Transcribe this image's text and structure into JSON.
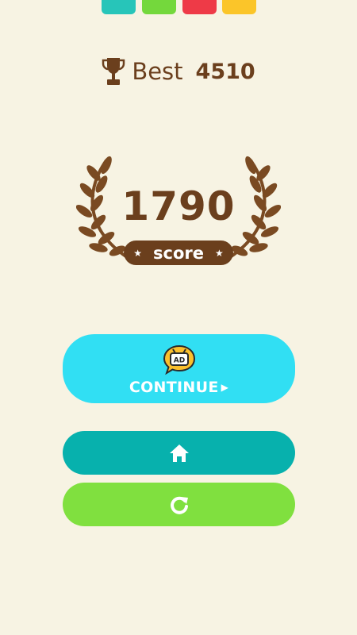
{
  "colors": {
    "background": "#f7f3e3",
    "brown": "#6b3f1d",
    "tile_colors": [
      "#27c5b9",
      "#74d83c",
      "#ee3a47",
      "#fbc529"
    ],
    "continue_button": "#31dff3",
    "home_button": "#07b1ad",
    "restart_button": "#80e03f",
    "ad_badge": "#fbc02d"
  },
  "header": {
    "trophy_icon": "trophy-icon",
    "best_label": "Best",
    "best_value": "4510"
  },
  "score": {
    "value": "1790",
    "label": "score"
  },
  "buttons": {
    "continue": {
      "ad_label": "AD",
      "label": "CONTINUE",
      "icon": "play-triangle-icon"
    },
    "home": {
      "icon": "home-icon"
    },
    "restart": {
      "icon": "restart-icon"
    }
  }
}
